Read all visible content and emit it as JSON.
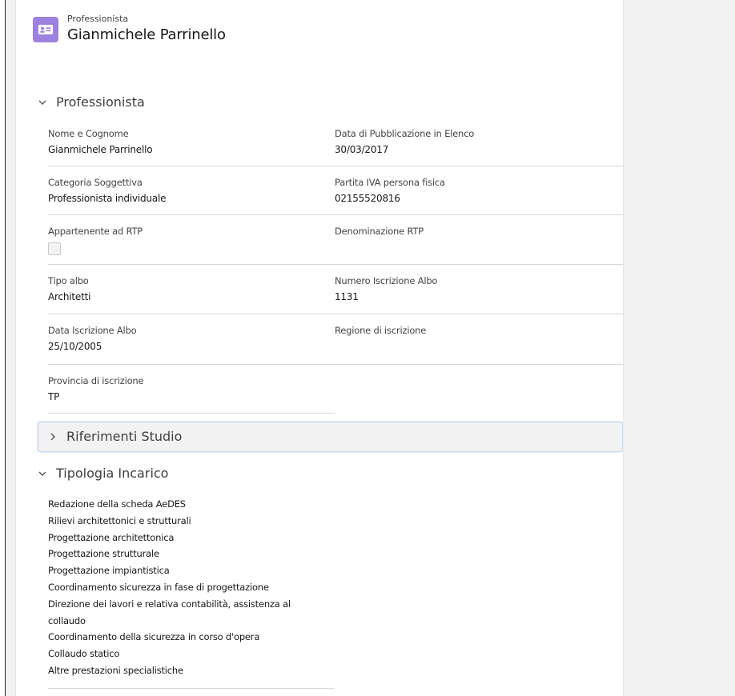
{
  "header": {
    "object_type": "Professionista",
    "record_name": "Gianmichele Parrinello"
  },
  "sections": {
    "professionista": {
      "title": "Professionista",
      "fields": {
        "nome_cognome": {
          "label": "Nome e Cognome",
          "value": "Gianmichele Parrinello"
        },
        "data_pubblicazione": {
          "label": "Data di Pubblicazione in Elenco",
          "value": "30/03/2017"
        },
        "categoria": {
          "label": "Categoria Soggettiva",
          "value": "Professionista individuale"
        },
        "partita_iva": {
          "label": "Partita IVA persona fisica",
          "value": "02155520816"
        },
        "appartenente_rtp": {
          "label": "Appartenente ad RTP",
          "checked": false
        },
        "denominazione_rtp": {
          "label": "Denominazione RTP",
          "value": ""
        },
        "tipo_albo": {
          "label": "Tipo albo",
          "value": "Architetti"
        },
        "numero_albo": {
          "label": "Numero Iscrizione Albo",
          "value": "1131"
        },
        "data_iscrizione": {
          "label": "Data Iscrizione Albo",
          "value": "25/10/2005"
        },
        "regione": {
          "label": "Regione di iscrizione",
          "value": ""
        },
        "provincia": {
          "label": "Provincia di iscrizione",
          "value": "TP"
        }
      }
    },
    "riferimenti_studio": {
      "title": "Riferimenti Studio",
      "expanded": false
    },
    "tipologia_incarico": {
      "title": "Tipologia Incarico",
      "items": [
        "Redazione della scheda AeDES",
        "Rilievi architettonici e strutturali",
        "Progettazione architettonica",
        "Progettazione strutturale",
        "Progettazione impiantistica",
        "Coordinamento sicurezza in fase di progettazione",
        "Direzione dei lavori e relativa contabilità, assistenza al",
        "collaudo",
        "Coordinamento della sicurezza in corso d'opera",
        "Collaudo statico",
        "Altre prestazioni specialistiche"
      ]
    }
  },
  "icons": {
    "record_icon": "contact-card-icon",
    "expanded_chevron": "chevron-down-icon",
    "collapsed_chevron": "chevron-right-icon"
  },
  "colors": {
    "record_icon_bg": "#9e81df",
    "page_bg": "#f3f2f2",
    "focus_border": "#c7d7ec"
  }
}
